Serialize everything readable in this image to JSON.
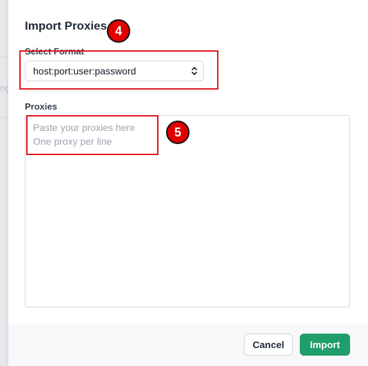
{
  "modal": {
    "title": "Import Proxies",
    "format_label": "Select Format",
    "format_selected": "host:port:user:password",
    "proxies_label": "Proxies",
    "proxies_placeholder_line1": "Paste your proxies here",
    "proxies_placeholder_line2": "One proxy per line"
  },
  "annotations": {
    "step_select": "4",
    "step_textarea": "5"
  },
  "footer": {
    "cancel_label": "Cancel",
    "import_label": "Import"
  },
  "background": {
    "left_glyph": "ng"
  },
  "colors": {
    "primary": "#1f9d6a",
    "highlight": "#e0141e",
    "badge": "#e00000"
  }
}
